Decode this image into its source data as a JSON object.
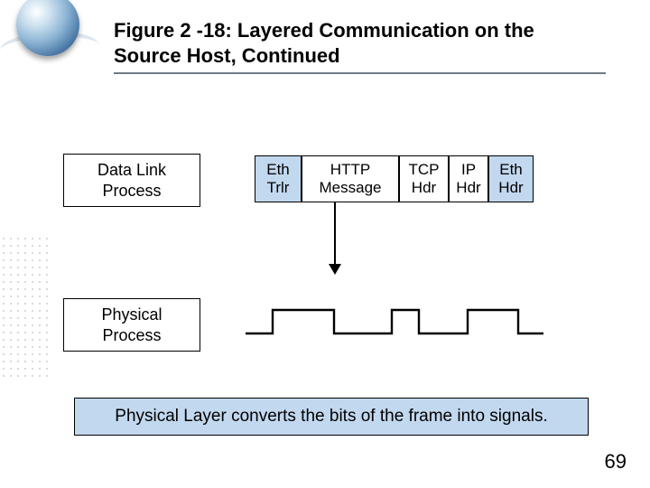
{
  "title": "Figure 2 -18: Layered Communication on the Source Host, Continued",
  "layers": {
    "data_link": "Data Link\nProcess",
    "physical": "Physical\nProcess"
  },
  "frame_segments": [
    {
      "line1": "Eth",
      "line2": "Trlr",
      "fill": "blue"
    },
    {
      "line1": "HTTP",
      "line2": "Message",
      "fill": "white"
    },
    {
      "line1": "TCP",
      "line2": "Hdr",
      "fill": "white"
    },
    {
      "line1": "IP",
      "line2": "Hdr",
      "fill": "white"
    },
    {
      "line1": "Eth",
      "line2": "Hdr",
      "fill": "blue"
    }
  ],
  "caption": "Physical Layer converts the bits of the frame into signals.",
  "page_number": "69"
}
